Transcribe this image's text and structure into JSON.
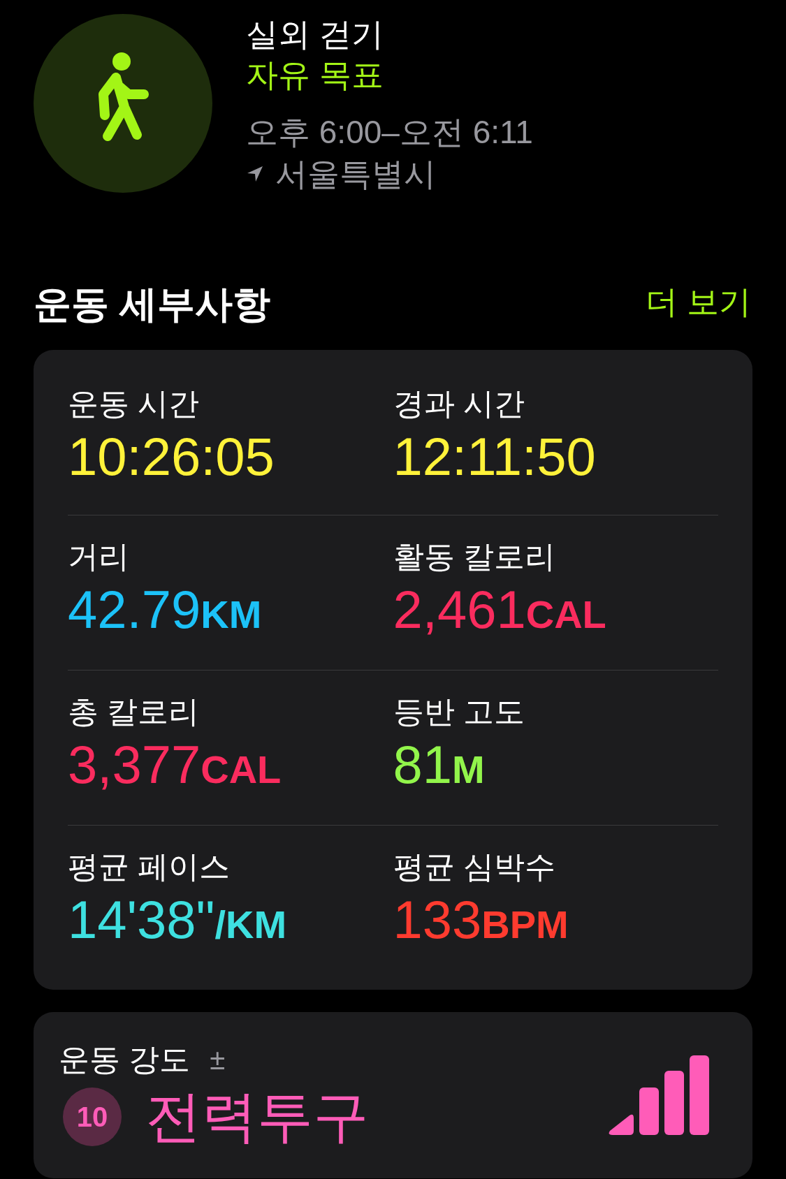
{
  "workout": {
    "title": "실외 걷기",
    "goal": "자유 목표",
    "time": "오후 6:00–오전 6:11",
    "location": "서울특별시"
  },
  "section": {
    "title": "운동 세부사항",
    "more": "더 보기"
  },
  "metrics": [
    {
      "label": "운동 시간",
      "value": "10:26:05",
      "color": "#fff23a"
    },
    {
      "label": "경과 시간",
      "value": "12:11:50",
      "color": "#fff23a"
    },
    {
      "label": "거리",
      "value": "42.79",
      "unit": "KM",
      "color": "#1cc2f8"
    },
    {
      "label": "활동 칼로리",
      "value": "2,461",
      "unit": "CAL",
      "color": "#fa2c5e"
    },
    {
      "label": "총 칼로리",
      "value": "3,377",
      "unit": "CAL",
      "color": "#fa2c5e"
    },
    {
      "label": "등반 고도",
      "value": "81",
      "unit": "M",
      "color": "#92f54b"
    },
    {
      "label": "평균 페이스",
      "value": "14'38\"",
      "unit": "/KM",
      "color": "#3ee0e0"
    },
    {
      "label": "평균 심박수",
      "value": "133",
      "unit": "BPM",
      "color": "#ff3b2f"
    }
  ],
  "effort": {
    "label": "운동 강도",
    "adjust": "±",
    "score": "10",
    "name": "전력투구"
  }
}
